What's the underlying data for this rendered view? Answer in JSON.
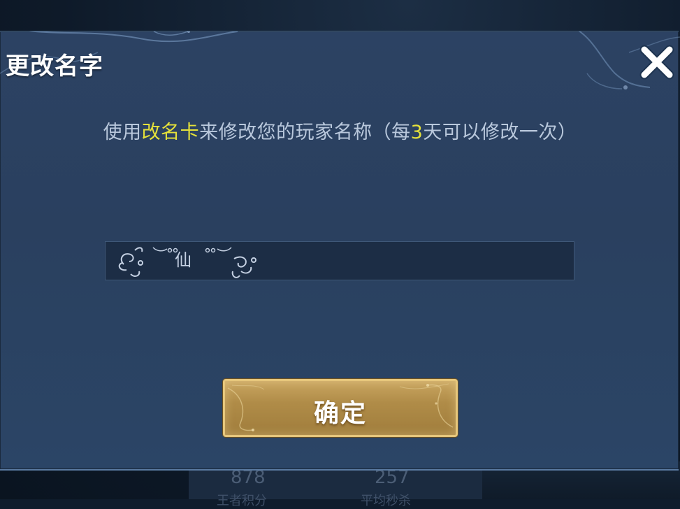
{
  "background": {
    "stats": [
      {
        "value": "878",
        "label": "王者积分"
      },
      {
        "value": "257",
        "label": "平均秒杀"
      }
    ]
  },
  "dialog": {
    "title": "更改名字",
    "description": {
      "prefix": "使用",
      "highlight1": "改名卡",
      "middle": "来修改您的玩家名称（每",
      "highlight2": "3",
      "suffix": "天可以修改一次）"
    },
    "name_field": {
      "decorated_value": "仙",
      "value": "",
      "placeholder": ""
    },
    "confirm_label": "确定",
    "close_icon": "close-x-icon"
  },
  "colors": {
    "dialog_bg": "#2c4263",
    "highlight": "#e6e23a",
    "button_gold": "#b08c48",
    "button_border": "#e7c77c",
    "text_muted": "#b9c8dc"
  }
}
